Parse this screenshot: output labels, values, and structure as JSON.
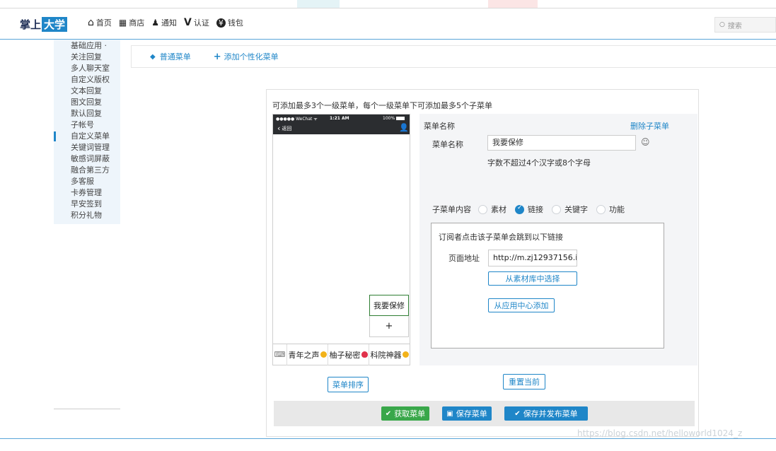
{
  "header": {
    "logo_main": "掌上",
    "logo_highlight": "大学",
    "nav": [
      {
        "icon": "home-icon",
        "glyph": "⌂",
        "label": "首页"
      },
      {
        "icon": "store-icon",
        "glyph": "■",
        "label": "商店"
      },
      {
        "icon": "bell-icon",
        "glyph": "♪",
        "label": "通知"
      },
      {
        "icon": "verify-icon",
        "glyph": "V",
        "label": "认证"
      },
      {
        "icon": "wallet-icon",
        "glyph": "¥",
        "label": "钱包"
      }
    ],
    "search_placeholder": "搜索"
  },
  "sidebar": {
    "items": [
      {
        "label": "基础应用 ·",
        "active": false
      },
      {
        "label": "关注回复",
        "active": false
      },
      {
        "label": "多人聊天室",
        "active": false
      },
      {
        "label": "自定义版权",
        "active": false
      },
      {
        "label": "文本回复",
        "active": false
      },
      {
        "label": "图文回复",
        "active": false
      },
      {
        "label": "默认回复",
        "active": false
      },
      {
        "label": "子帐号",
        "active": false
      },
      {
        "label": "自定义菜单",
        "active": true
      },
      {
        "label": "关键词管理",
        "active": false
      },
      {
        "label": "敏感词屏蔽",
        "active": false
      },
      {
        "label": "融合第三方",
        "active": false
      },
      {
        "label": "多客服",
        "active": false
      },
      {
        "label": "卡券管理",
        "active": false
      },
      {
        "label": "早安签到",
        "active": false
      },
      {
        "label": "积分礼物",
        "active": false
      }
    ]
  },
  "tabs": {
    "normal": "普通菜单",
    "personal": "添加个性化菜单"
  },
  "panel": {
    "hint": "可添加最多3个一级菜单，每个一级菜单下可添加最多5个子菜单"
  },
  "phone": {
    "signal": "●●●●● WeChat ᯤ",
    "time": "1:21 AM",
    "battery": "100%",
    "back": "返回",
    "submenu_item": "我要保修",
    "submenu_add": "+",
    "bottom_menus": [
      {
        "label": "青年之声",
        "emoji": "smile"
      },
      {
        "label": "柚子秘密",
        "emoji": "heart"
      },
      {
        "label": "科院神器",
        "emoji": "smile"
      }
    ]
  },
  "editor": {
    "title": "菜单名称",
    "delete": "删除子菜单",
    "name_label": "菜单名称",
    "name_value": "我要保修",
    "name_tip": "字数不超过4个汉字或8个字母",
    "content_label": "子菜单内容",
    "options": [
      {
        "label": "素材",
        "checked": false
      },
      {
        "label": "链接",
        "checked": true
      },
      {
        "label": "关键字",
        "checked": false
      },
      {
        "label": "功能",
        "checked": false
      }
    ],
    "link_hint": "订阅者点击该子菜单会跳到以下链接",
    "url_label": "页面地址",
    "url_value": "http://m.zj12937156.i",
    "from_library": "从素材库中选择",
    "from_app": "从应用中心添加"
  },
  "actions": {
    "sort": "菜单排序",
    "reset": "重置当前",
    "fetch": "获取菜单",
    "save": "保存菜单",
    "save_publish": "保存并发布菜单"
  },
  "watermark": "https://blog.csdn.net/helloworld1024_z"
}
